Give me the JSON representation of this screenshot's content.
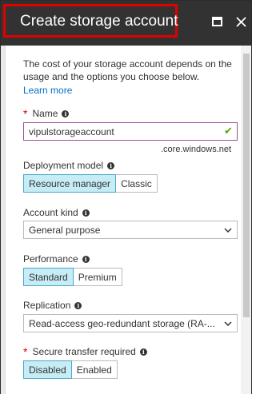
{
  "header": {
    "title": "Create storage account"
  },
  "intro": {
    "description": "The cost of your storage account depends on the usage and the options you choose below.",
    "learn_more": "Learn more"
  },
  "name_field": {
    "label": "Name",
    "value": "vipulstorageaccount",
    "suffix": ".core.windows.net",
    "required": "*"
  },
  "deployment_model": {
    "label": "Deployment model",
    "options": [
      "Resource manager",
      "Classic"
    ],
    "selected": "Resource manager"
  },
  "account_kind": {
    "label": "Account kind",
    "value": "General purpose"
  },
  "performance": {
    "label": "Performance",
    "options": [
      "Standard",
      "Premium"
    ],
    "selected": "Standard"
  },
  "replication": {
    "label": "Replication",
    "value": "Read-access geo-redundant storage (RA-..."
  },
  "secure_transfer": {
    "label": "Secure transfer required",
    "required": "*",
    "options": [
      "Disabled",
      "Enabled"
    ],
    "selected": "Disabled"
  },
  "icons": {
    "info": "info-icon",
    "check": "checkmark-icon",
    "chevron": "chevron-down-icon",
    "maximize": "maximize-icon",
    "close": "close-icon"
  },
  "colors": {
    "header_bg": "#323232",
    "highlight": "#e00000",
    "accent": "#0072c6",
    "selected_bg": "#c6ecf5",
    "valid": "#57a300",
    "input_border": "#9b4f96"
  }
}
